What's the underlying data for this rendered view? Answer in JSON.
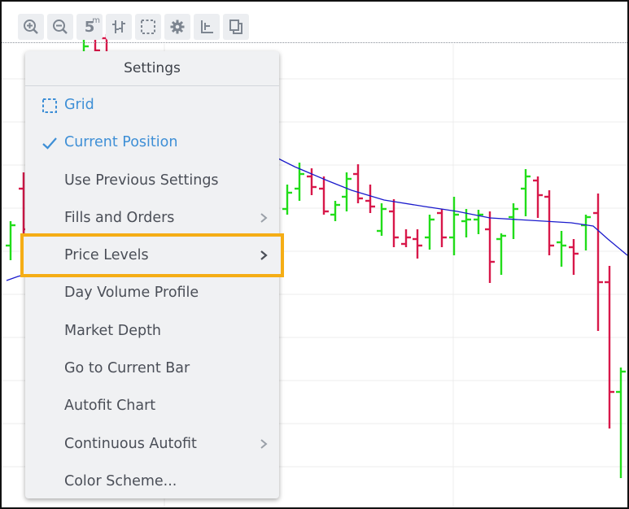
{
  "toolbar": {
    "buttons": [
      {
        "icon": "zoom-in-icon"
      },
      {
        "icon": "zoom-out-icon"
      },
      {
        "icon": "timeframe",
        "label": "5",
        "sup": "m"
      },
      {
        "icon": "bar-type-icon"
      },
      {
        "icon": "selection-icon"
      },
      {
        "icon": "gear-icon"
      },
      {
        "icon": "align-icon"
      },
      {
        "icon": "layout-icon"
      }
    ]
  },
  "menu": {
    "title": "Settings",
    "items": [
      {
        "label": "Grid",
        "icon": "grid-icon",
        "active": true,
        "submenu": false
      },
      {
        "label": "Current Position",
        "icon": "check-icon",
        "active": true,
        "submenu": false
      },
      {
        "label": "Use Previous Settings",
        "active": false,
        "submenu": false
      },
      {
        "label": "Fills and Orders",
        "active": false,
        "submenu": true
      },
      {
        "label": "Price Levels",
        "active": false,
        "submenu": true,
        "highlighted": true
      },
      {
        "label": "Day Volume Profile",
        "active": false,
        "submenu": false
      },
      {
        "label": "Market Depth",
        "active": false,
        "submenu": false
      },
      {
        "label": "Go to Current Bar",
        "active": false,
        "submenu": false
      },
      {
        "label": "Autofit Chart",
        "active": false,
        "submenu": false
      },
      {
        "label": "Continuous Autofit",
        "active": false,
        "submenu": true
      },
      {
        "label": "Color Scheme...",
        "active": false,
        "submenu": false
      }
    ]
  },
  "colors": {
    "up_bar": "#22dd1a",
    "down_bar": "#d8184a",
    "moving_average": "#1a1acc",
    "active_item": "#3e8fd6",
    "highlight_outline": "#f5ad15",
    "grid": "#ececec"
  }
}
